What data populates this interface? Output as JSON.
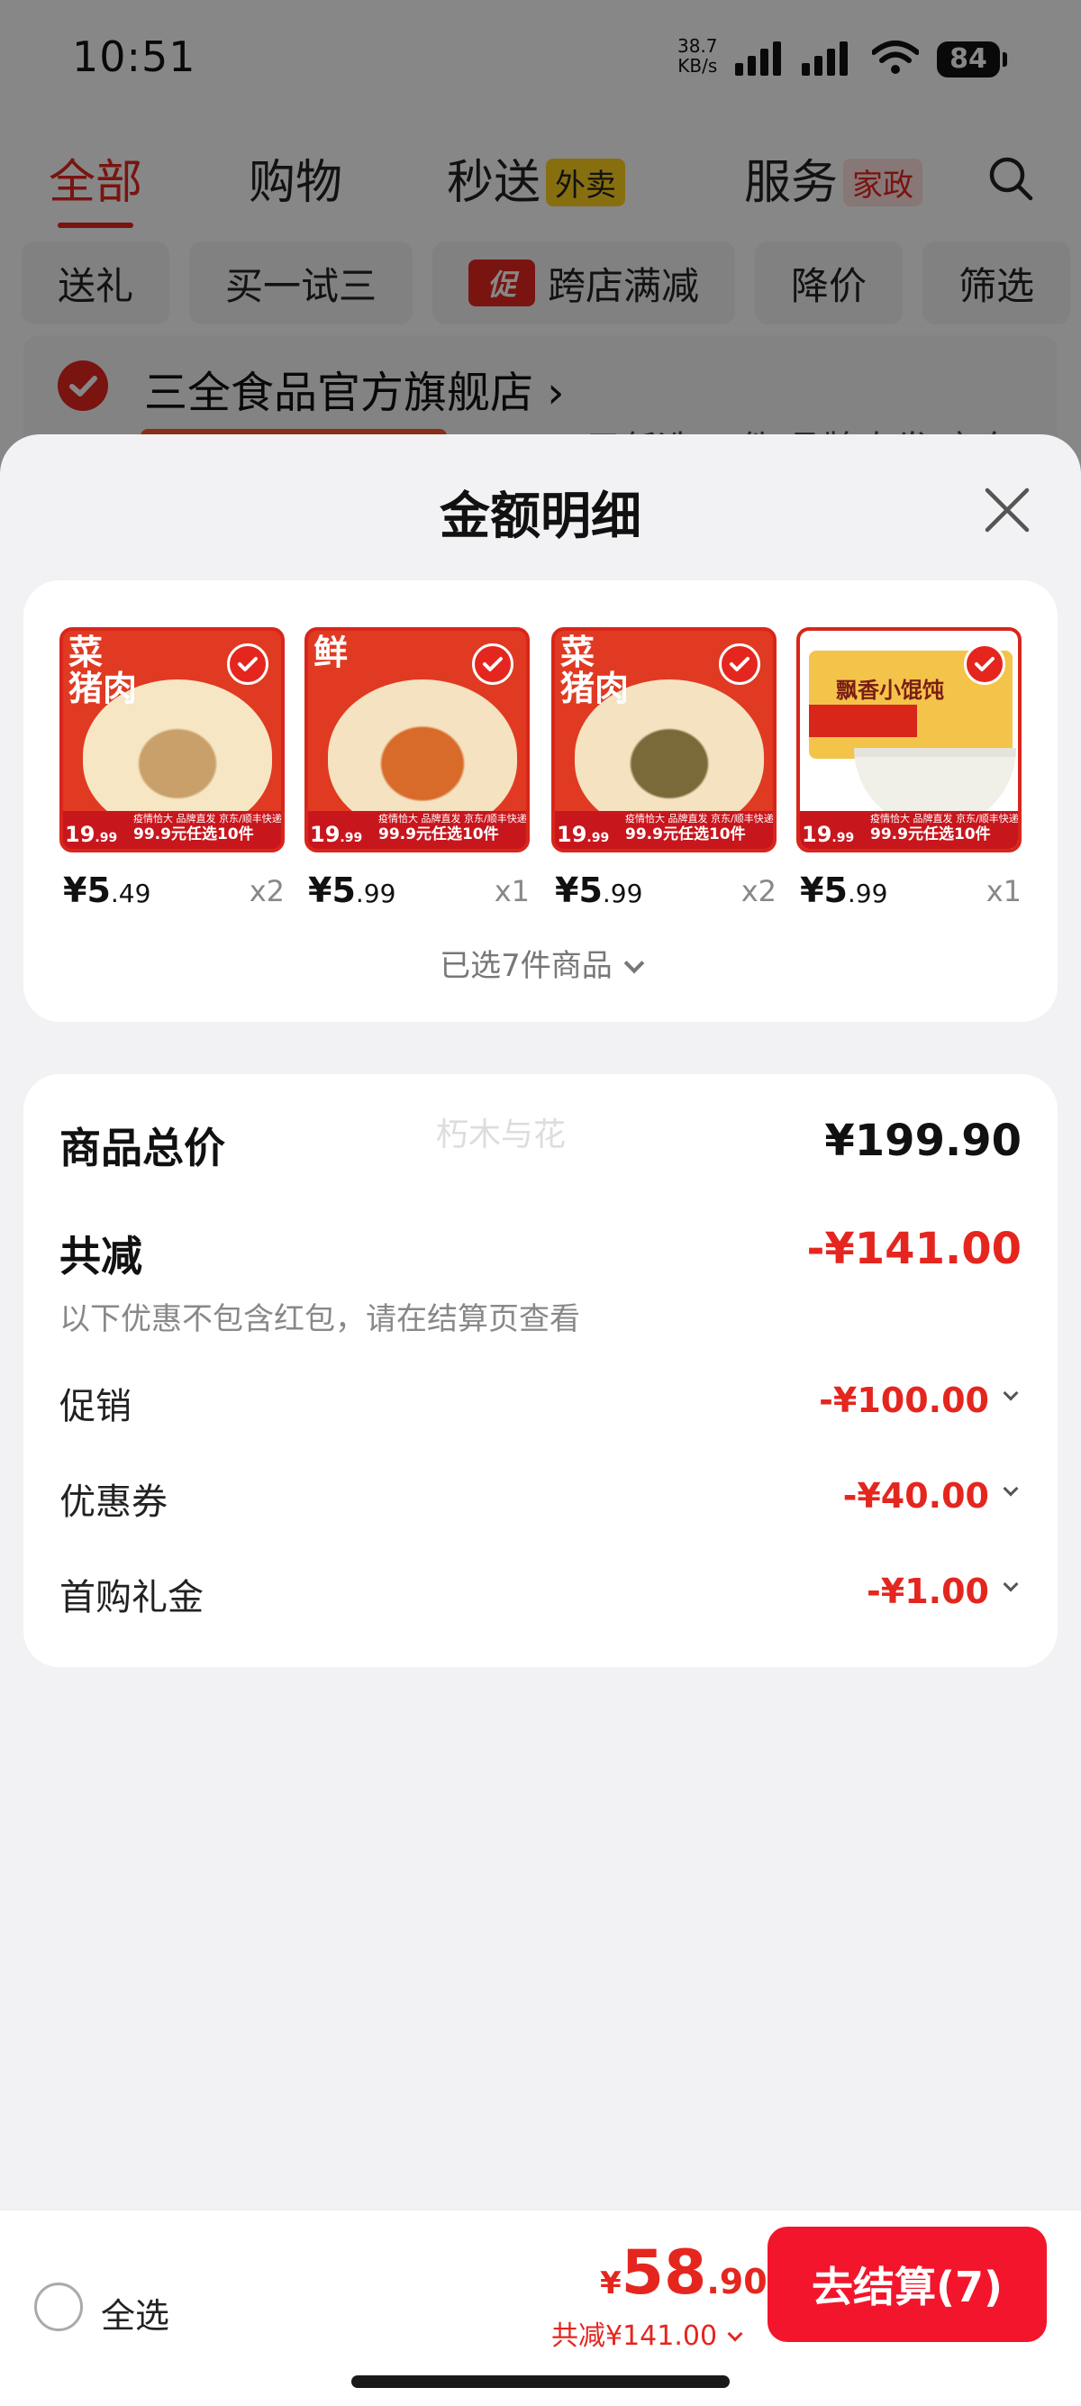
{
  "status_bar": {
    "time": "10:51",
    "net_speed_value": "38.7",
    "net_speed_unit": "KB/s",
    "battery": "84"
  },
  "nav_tabs": [
    {
      "label": "全部",
      "badge": ""
    },
    {
      "label": "购物",
      "badge": ""
    },
    {
      "label": "秒送",
      "badge": "外卖"
    },
    {
      "label": "服务",
      "badge": "家政"
    }
  ],
  "filter_chips": [
    {
      "label": "送礼",
      "icon_text": ""
    },
    {
      "label": "买一试三",
      "icon_text": ""
    },
    {
      "label": "跨店满减",
      "icon_text": "促"
    },
    {
      "label": "降价",
      "icon_text": ""
    },
    {
      "label": "筛选",
      "icon_text": ""
    }
  ],
  "store": {
    "name": "三全食品官方旗舰店",
    "arrow": "›",
    "peek_text": "9.9元任选10件 品牌直发 京东"
  },
  "sheet": {
    "title": "金额明细",
    "products": [
      {
        "img_title": "菜\n猪肉",
        "strip_price": "19",
        "strip_price_dec": ".99",
        "strip_text": "99.9元任选10件",
        "strip_top": "疫情恰大 品牌直发 京东/顺丰快递",
        "price_int": "¥5",
        "price_dec": ".49",
        "qty": "x2"
      },
      {
        "img_title": "鲜",
        "strip_price": "19",
        "strip_price_dec": ".99",
        "strip_text": "99.9元任选10件",
        "strip_top": "疫情恰大 品牌直发 京东/顺丰快递",
        "price_int": "¥5",
        "price_dec": ".99",
        "qty": "x1"
      },
      {
        "img_title": "菜\n猪肉",
        "strip_price": "19",
        "strip_price_dec": ".99",
        "strip_text": "99.9元任选10件",
        "strip_top": "疫情恰大 品牌直发 京东/顺丰快递",
        "price_int": "¥5",
        "price_dec": ".99",
        "qty": "x2"
      },
      {
        "img_title": "飘香小馄饨",
        "strip_price": "19",
        "strip_price_dec": ".99",
        "strip_text": "99.9元任选10件",
        "strip_top": "疫情恰大 品牌直发 京东/顺丰快递",
        "price_int": "¥5",
        "price_dec": ".99",
        "qty": "x1"
      }
    ],
    "selected_summary": "已选7件商品",
    "summary": {
      "total_label": "商品总价",
      "total_value": "¥199.90",
      "watermark": "朽木与花",
      "reduce_label": "共减",
      "reduce_value": "-¥141.00",
      "reduce_note": "以下优惠不包含红包，请在结算页查看",
      "items": [
        {
          "label": "促销",
          "value": "-¥100.00"
        },
        {
          "label": "优惠券",
          "value": "-¥40.00"
        },
        {
          "label": "首购礼金",
          "value": "-¥1.00"
        }
      ]
    }
  },
  "bottom_bar": {
    "select_all_label": "全选",
    "price_currency": "¥",
    "price_int": "58",
    "price_dec": ".90",
    "saving_text": "共减¥141.00",
    "checkout_label": "去结算(7)"
  },
  "colors": {
    "accent_red": "#e4261f",
    "checkout_red": "#f3152c"
  }
}
